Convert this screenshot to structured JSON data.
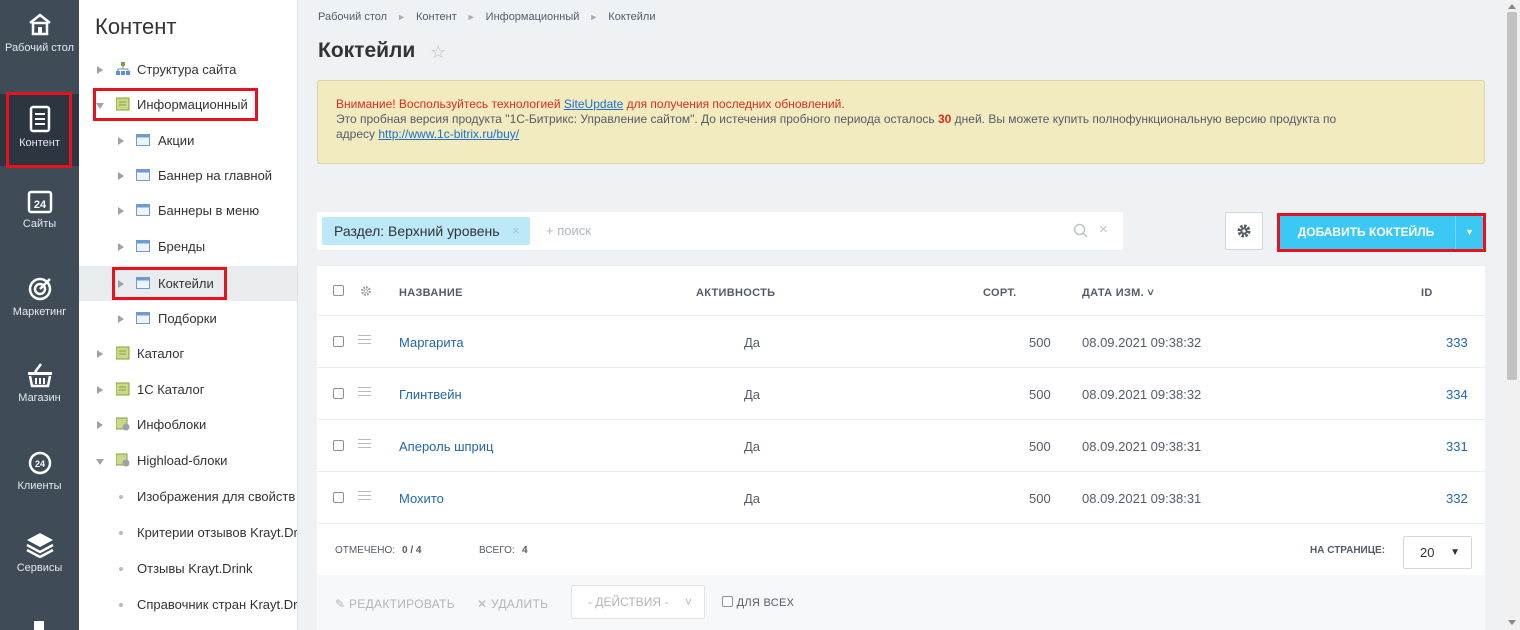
{
  "iconbar": {
    "items": [
      {
        "label": "Рабочий стол",
        "icon": "home-icon"
      },
      {
        "label": "Контент",
        "icon": "document-icon"
      },
      {
        "label": "Сайты",
        "icon": "calendar-24-icon"
      },
      {
        "label": "Маркетинг",
        "icon": "target-icon"
      },
      {
        "label": "Магазин",
        "icon": "basket-icon"
      },
      {
        "label": "Клиенты",
        "icon": "clients-icon"
      },
      {
        "label": "Сервисы",
        "icon": "layers-icon"
      }
    ]
  },
  "tree": {
    "title": "Контент",
    "items": [
      {
        "label": "Структура сайта"
      },
      {
        "label": "Информационный"
      },
      {
        "label": "Акции"
      },
      {
        "label": "Баннер на главной"
      },
      {
        "label": "Баннеры в меню"
      },
      {
        "label": "Бренды"
      },
      {
        "label": "Коктейли"
      },
      {
        "label": "Подборки"
      },
      {
        "label": "Каталог"
      },
      {
        "label": "1С Каталог"
      },
      {
        "label": "Инфоблоки"
      },
      {
        "label": "Highload-блоки"
      },
      {
        "label": "Изображения для свойств"
      },
      {
        "label": "Критерии отзывов Krayt.Dr"
      },
      {
        "label": "Отзывы Krayt.Drink"
      },
      {
        "label": "Справочник стран Krayt.Dr"
      }
    ]
  },
  "breadcrumb": [
    "Рабочий стол",
    "Контент",
    "Информационный",
    "Коктейли"
  ],
  "page_title": "Коктейли",
  "notice": {
    "warn_prefix": "Внимание! Воспользуйтесь технологией ",
    "warn_link": "SiteUpdate",
    "warn_suffix": " для получения последних обновлений.",
    "line2_prefix": "Это пробная версия продукта \"1С-Битрикс: Управление сайтом\". До истечения пробного периода осталось ",
    "days": "30",
    "line2_suffix": " дней. Вы можете купить полнофункциональную версию продукта по",
    "line3_prefix": "адресу ",
    "buy_link": "http://www.1c-bitrix.ru/buy/"
  },
  "filter": {
    "chip": "Раздел: Верхний уровень",
    "chip_close": "×",
    "search_placeholder": "+ поиск",
    "clear": "×"
  },
  "add_button": {
    "label": "ДОБАВИТЬ КОКТЕЙЛЬ",
    "dropdown": "▼"
  },
  "grid": {
    "headers": {
      "name": "НАЗВАНИЕ",
      "active": "АКТИВНОСТЬ",
      "sort": "СОРТ.",
      "date": "ДАТА ИЗМ. ˅",
      "id": "ID"
    },
    "rows": [
      {
        "name": "Маргарита",
        "active": "Да",
        "sort": "500",
        "date": "08.09.2021 09:38:32",
        "id": "333"
      },
      {
        "name": "Глинтвейн",
        "active": "Да",
        "sort": "500",
        "date": "08.09.2021 09:38:32",
        "id": "334"
      },
      {
        "name": "Апероль шприц",
        "active": "Да",
        "sort": "500",
        "date": "08.09.2021 09:38:31",
        "id": "331"
      },
      {
        "name": "Мохито",
        "active": "Да",
        "sort": "500",
        "date": "08.09.2021 09:38:31",
        "id": "332"
      }
    ],
    "footer": {
      "checked_label": "ОТМЕЧЕНО:",
      "checked_value": "0 / 4",
      "total_label": "ВСЕГО:",
      "total_value": "4",
      "per_page_label": "НА СТРАНИЦЕ:",
      "per_page_value": "20"
    }
  },
  "actions": {
    "edit": "РЕДАКТИРОВАТЬ",
    "delete": "УДАЛИТЬ",
    "select": "- ДЕЙСТВИЯ -",
    "for_all": "ДЛЯ ВСЕХ"
  },
  "colors": {
    "accent": "#3bc8f5",
    "highlight": "#e8121f",
    "sidebar": "#3f4b56"
  }
}
